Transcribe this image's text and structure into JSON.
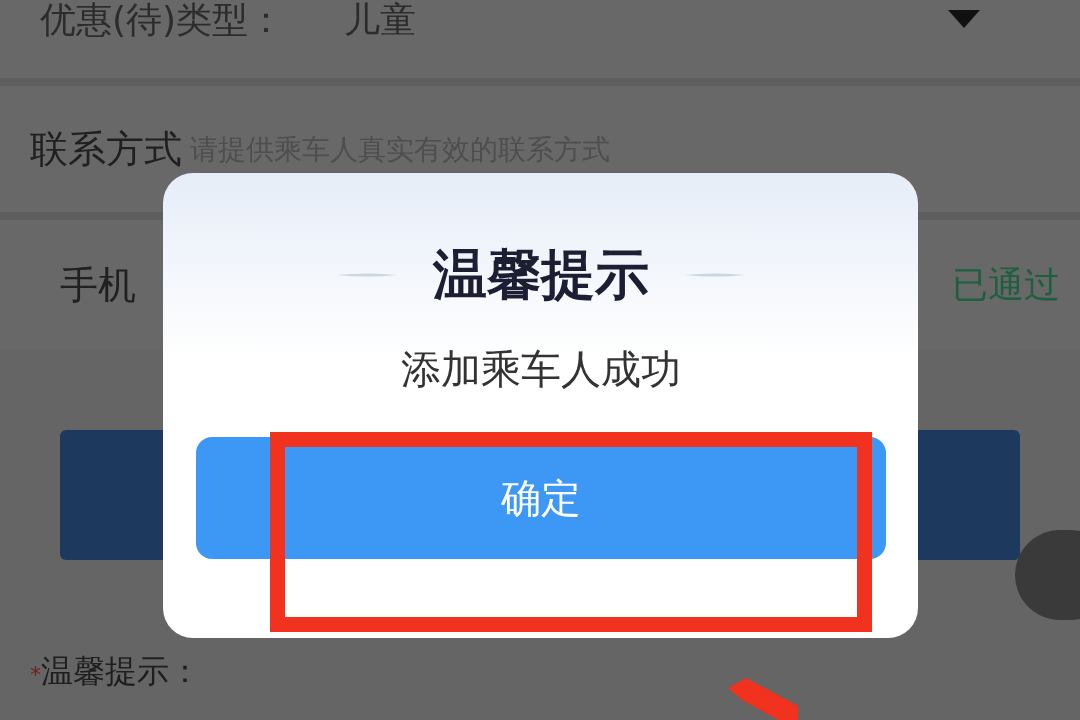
{
  "form": {
    "discount_type": {
      "label": "优惠(待)类型：",
      "value": "儿童"
    },
    "contact": {
      "label": "联系方式",
      "placeholder": "请提供乘车人真实有效的联系方式"
    },
    "phone": {
      "label": "手机",
      "status": "已通过"
    },
    "notice": {
      "marker": "*",
      "label": "温馨提示："
    }
  },
  "dialog": {
    "title": "温馨提示",
    "message": "添加乘车人成功",
    "buttons": [
      {
        "label": "确定"
      }
    ]
  }
}
